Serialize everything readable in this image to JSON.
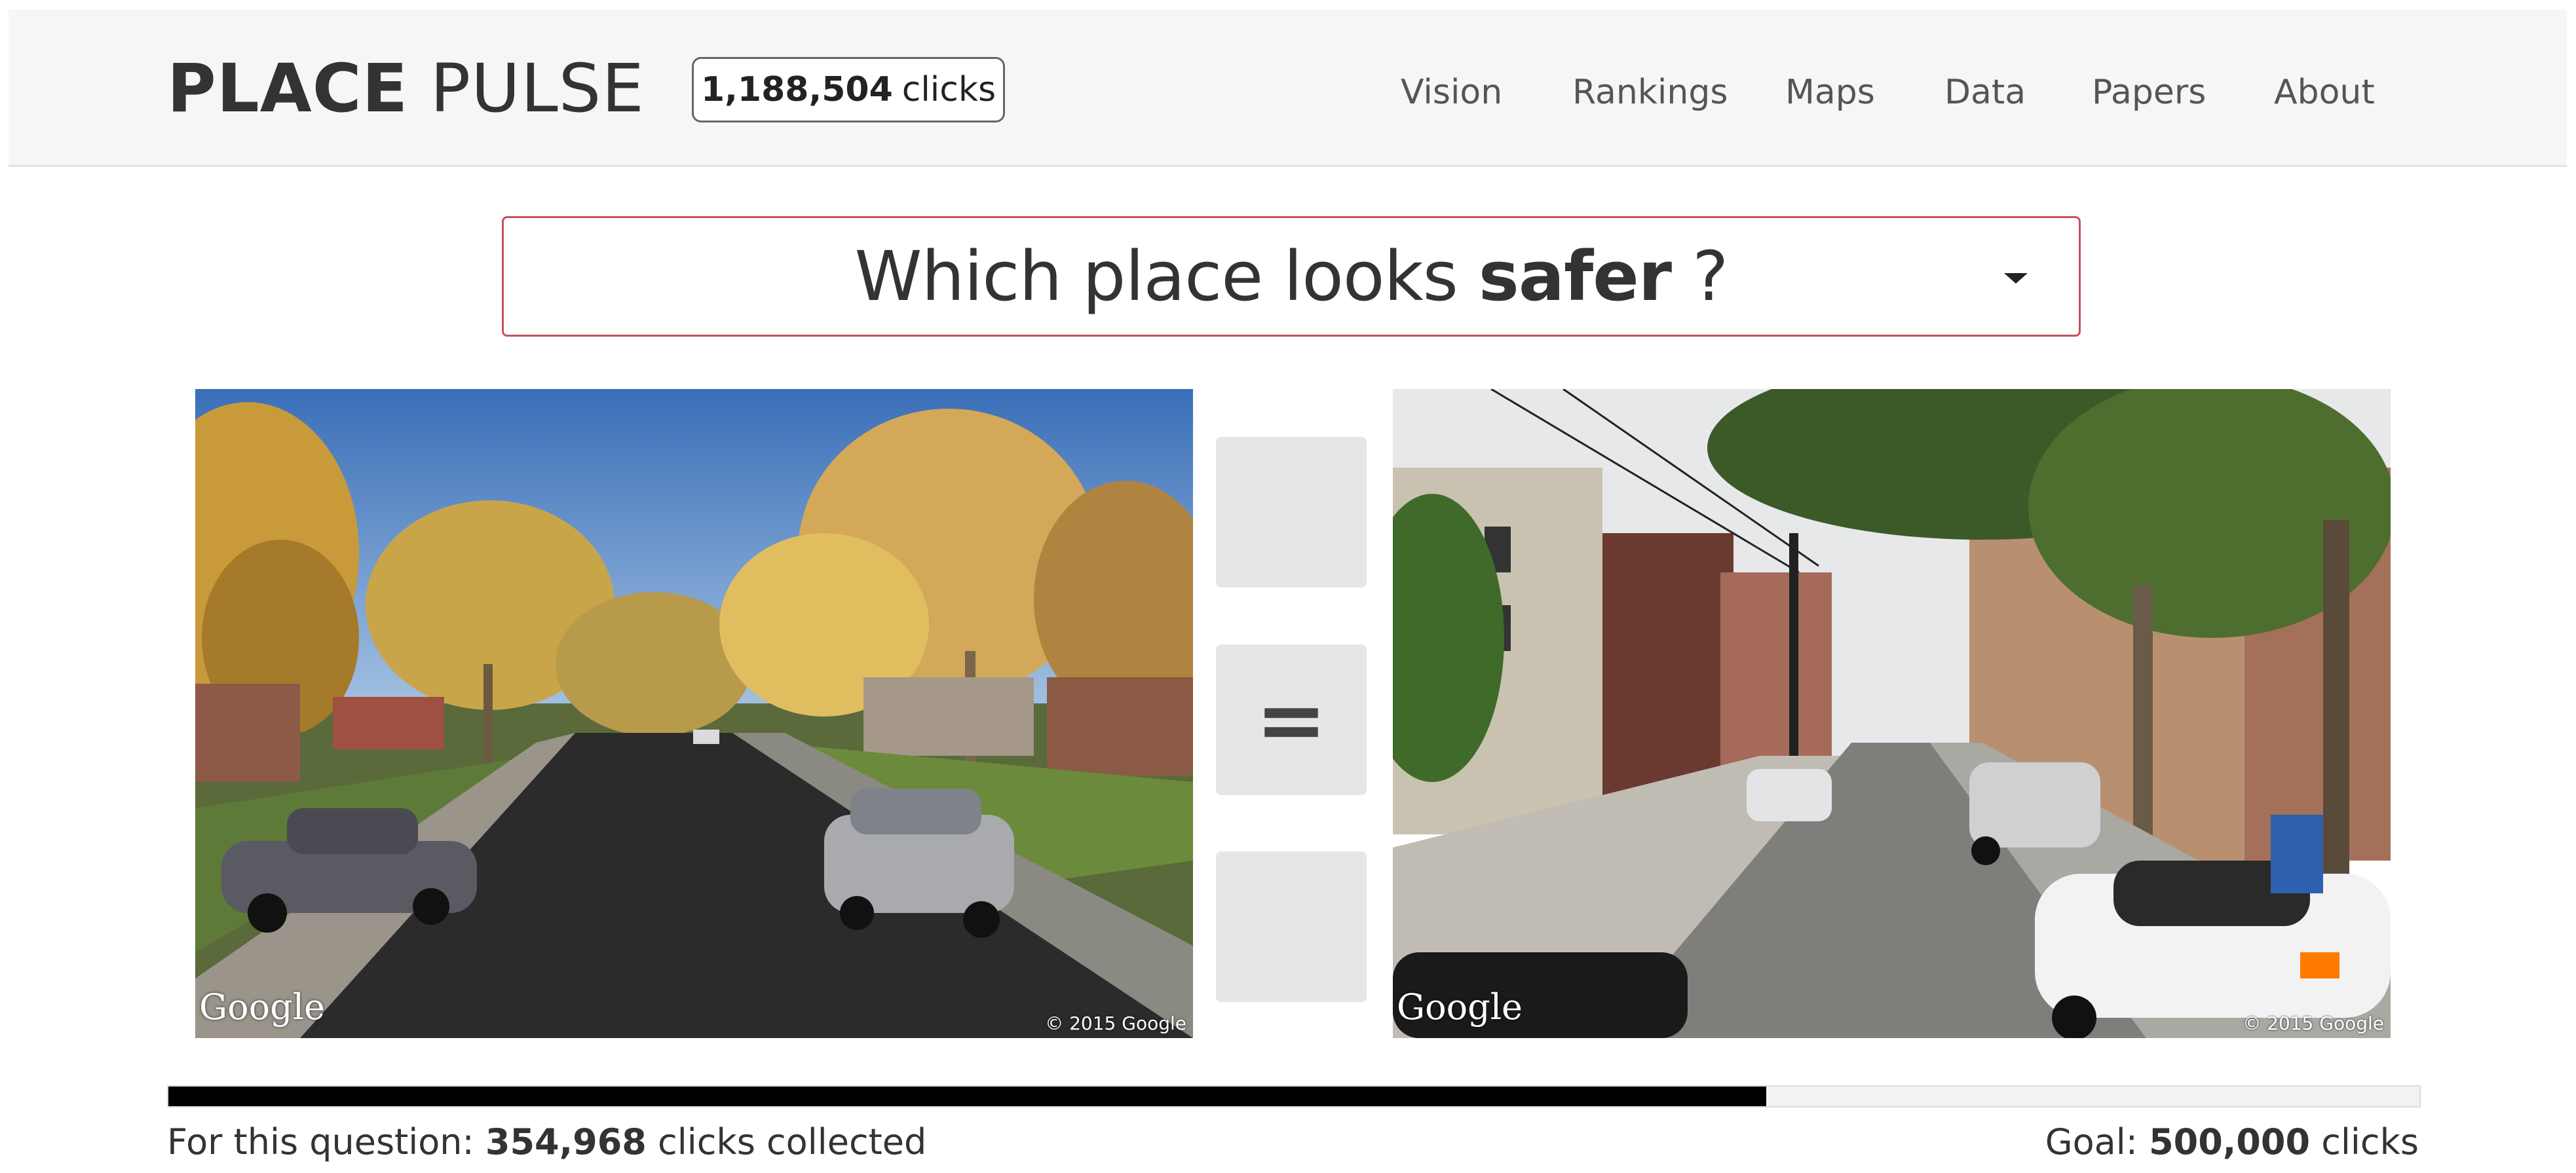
{
  "brand": {
    "bold": "PLACE",
    "light": "PULSE"
  },
  "clicks_badge": {
    "count": "1,188,504",
    "unit": "clicks"
  },
  "nav": [
    {
      "label": "Vision"
    },
    {
      "label": "Rankings"
    },
    {
      "label": "Maps"
    },
    {
      "label": "Data"
    },
    {
      "label": "Papers"
    },
    {
      "label": "About"
    }
  ],
  "question": {
    "prefix": "Which place looks",
    "attribute": "safer",
    "suffix": "?"
  },
  "images": {
    "left": {
      "logo": "Google",
      "copyright": "© 2015 Google"
    },
    "right": {
      "logo": "Google",
      "copyright": "© 2015 Google"
    }
  },
  "vote_buttons": {
    "left": {
      "icon": "arrow-left-icon",
      "glyph": ""
    },
    "equal": {
      "icon": "equal-icon",
      "glyph": "="
    },
    "right": {
      "icon": "arrow-right-icon",
      "glyph": ""
    }
  },
  "progress": {
    "collected": 354968,
    "goal": 500000,
    "label_prefix": "For this question:",
    "collected_text": "354,968",
    "collected_suffix": "clicks collected",
    "goal_prefix": "Goal:",
    "goal_text": "500,000",
    "goal_suffix": "clicks"
  },
  "colors": {
    "question_border": "#c9505f",
    "progress_fill": "#000000",
    "navbar_bg": "#f6f6f6"
  }
}
